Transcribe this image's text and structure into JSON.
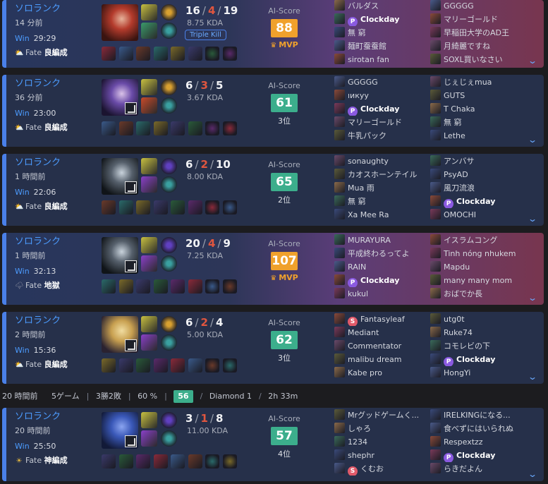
{
  "labels": {
    "ai_score": "AI-Score",
    "mvp": "MVP",
    "expand": "⌄",
    "crown": "♛"
  },
  "summary": {
    "ago": "20 時間前",
    "games": "5ゲーム",
    "record": "3勝2敗",
    "winrate": "60 %",
    "score": "56",
    "rank": "Diamond 1",
    "duration": "2h 33m"
  },
  "matches": [
    {
      "queue": "ソロランク",
      "ago": "14 分前",
      "result": "Win",
      "duration": "29:29",
      "fate_prefix": "Fate",
      "fate": "良編成",
      "fate_icon": "sun-cloud-icon",
      "kills": "16",
      "deaths": "4",
      "assists": "19",
      "kda": "8.75 KDA",
      "badge": "Triple Kill",
      "ai": "88",
      "ai_color": "gold",
      "place": "MVP",
      "team1": [
        "バルダス",
        "Clockday",
        "無 窮",
        "麺町蚕蚕館",
        "sirotan fan"
      ],
      "team2": [
        "GGGGG",
        "マリーゴールド",
        "早稲田大学のAD王",
        "月綺麗ですね",
        "SOXL買いなさい"
      ]
    },
    {
      "queue": "ソロランク",
      "ago": "36 分前",
      "result": "Win",
      "duration": "23:00",
      "fate_prefix": "Fate",
      "fate": "良編成",
      "fate_icon": "sun-cloud-icon",
      "kills": "6",
      "deaths": "3",
      "assists": "5",
      "kda": "3.67 KDA",
      "badge": "",
      "ai": "61",
      "ai_color": "teal",
      "place": "3位",
      "team1": [
        "GGGGG",
        "ıикуу",
        "Clockday",
        "マリーゴールド",
        "牛乳パック"
      ],
      "team2": [
        "じぇじぇmua",
        "GUTS",
        "T Chaka",
        "無 窮",
        "Lethe"
      ]
    },
    {
      "queue": "ソロランク",
      "ago": "1 時間前",
      "result": "Win",
      "duration": "22:06",
      "fate_prefix": "Fate",
      "fate": "良編成",
      "fate_icon": "sun-cloud-icon",
      "kills": "6",
      "deaths": "2",
      "assists": "10",
      "kda": "8.00 KDA",
      "badge": "",
      "ai": "65",
      "ai_color": "teal",
      "place": "2位",
      "team1": [
        "sonaughty",
        "カオスホーンテイル",
        "Mua 雨",
        "無 窮",
        "Xa Mee Ra"
      ],
      "team2": [
        "アンバサ",
        "PsyAD",
        "風刀流浪",
        "Clockday",
        "OMOCHI"
      ]
    },
    {
      "queue": "ソロランク",
      "ago": "1 時間前",
      "result": "Win",
      "duration": "32:13",
      "fate_prefix": "Fate",
      "fate": "地獄",
      "fate_icon": "storm-icon",
      "kills": "20",
      "deaths": "4",
      "assists": "9",
      "kda": "7.25 KDA",
      "badge": "",
      "ai": "107",
      "ai_color": "gold",
      "place": "MVP",
      "team1": [
        "MURAYURA",
        "平成終わるってよ",
        "RAIN",
        "Clockday",
        "kukul"
      ],
      "team2": [
        "イスラムコング",
        "Tinh nóng nhukem",
        "Mapdu",
        "many many mom",
        "おばでか長"
      ]
    },
    {
      "queue": "ソロランク",
      "ago": "2 時間前",
      "result": "Win",
      "duration": "15:36",
      "fate_prefix": "Fate",
      "fate": "良編成",
      "fate_icon": "sun-cloud-icon",
      "kills": "6",
      "deaths": "2",
      "assists": "4",
      "kda": "5.00 KDA",
      "badge": "",
      "ai": "62",
      "ai_color": "teal",
      "place": "3位",
      "team1": [
        "Fantasyleaf",
        "Mediant",
        "Commentator",
        "malibu dream",
        "Kabe pro"
      ],
      "team2": [
        "utg0t",
        "Ruke74",
        "コモレビの下",
        "Clockday",
        "HongYi"
      ]
    },
    {
      "queue": "ソロランク",
      "ago": "20 時間前",
      "result": "Win",
      "duration": "25:50",
      "fate_prefix": "Fate",
      "fate": "神編成",
      "fate_icon": "sunburst-icon",
      "kills": "3",
      "deaths": "1",
      "assists": "8",
      "kda": "11.00 KDA",
      "badge": "",
      "ai": "57",
      "ai_color": "teal",
      "place": "4位",
      "team1": [
        "Mrグッドゲームく...",
        "しゃろ",
        "1234",
        "shephr",
        "くむお"
      ],
      "team2": [
        "IRELKINGになる...",
        "食べずにはいられぬ",
        "Respextzz",
        "Clockday",
        "らきだよん"
      ]
    }
  ],
  "badges": {
    "p": "P",
    "s": "S"
  }
}
